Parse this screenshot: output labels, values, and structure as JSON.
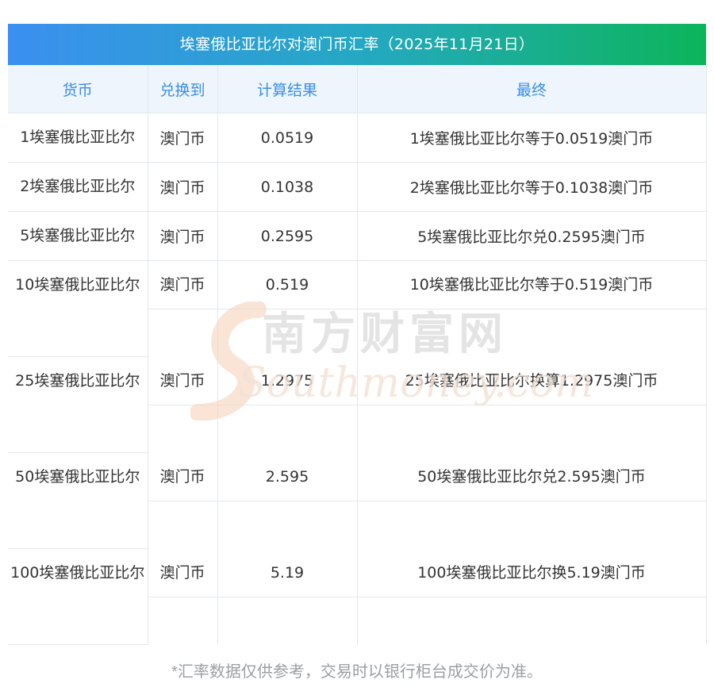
{
  "title": "埃塞俄比亚比尔对澳门币汇率（2025年11月21日）",
  "headers": [
    "货币",
    "兑换到",
    "计算结果",
    "最终"
  ],
  "rows": [
    {
      "currency": "1埃塞俄比亚比尔",
      "to": "澳门币",
      "result": "0.0519",
      "final": "1埃塞俄比亚比尔等于0.0519澳门币"
    },
    {
      "currency": "2埃塞俄比亚比尔",
      "to": "澳门币",
      "result": "0.1038",
      "final": "2埃塞俄比亚比尔等于0.1038澳门币"
    },
    {
      "currency": "5埃塞俄比亚比尔",
      "to": "澳门币",
      "result": "0.2595",
      "final": "5埃塞俄比亚比尔兑0.2595澳门币"
    },
    {
      "currency": "10埃塞俄比亚比尔",
      "to": "澳门币",
      "result": "0.519",
      "final": "10埃塞俄比亚比尔等于0.519澳门币"
    },
    {
      "currency": "25埃塞俄比亚比尔",
      "to": "澳门币",
      "result": "1.2975",
      "final": "25埃塞俄比亚比尔换算1.2975澳门币"
    },
    {
      "currency": "50埃塞俄比亚比尔",
      "to": "澳门币",
      "result": "2.595",
      "final": "50埃塞俄比亚比尔兑2.595澳门币"
    },
    {
      "currency": "100埃塞俄比亚比尔",
      "to": "澳门币",
      "result": "5.19",
      "final": "100埃塞俄比亚比尔换5.19澳门币"
    }
  ],
  "watermark": {
    "cn": "南方财富网",
    "en": "Southmoney.com"
  },
  "footnote": "*汇率数据仅供参考，交易时以银行柜台成交价为准。"
}
